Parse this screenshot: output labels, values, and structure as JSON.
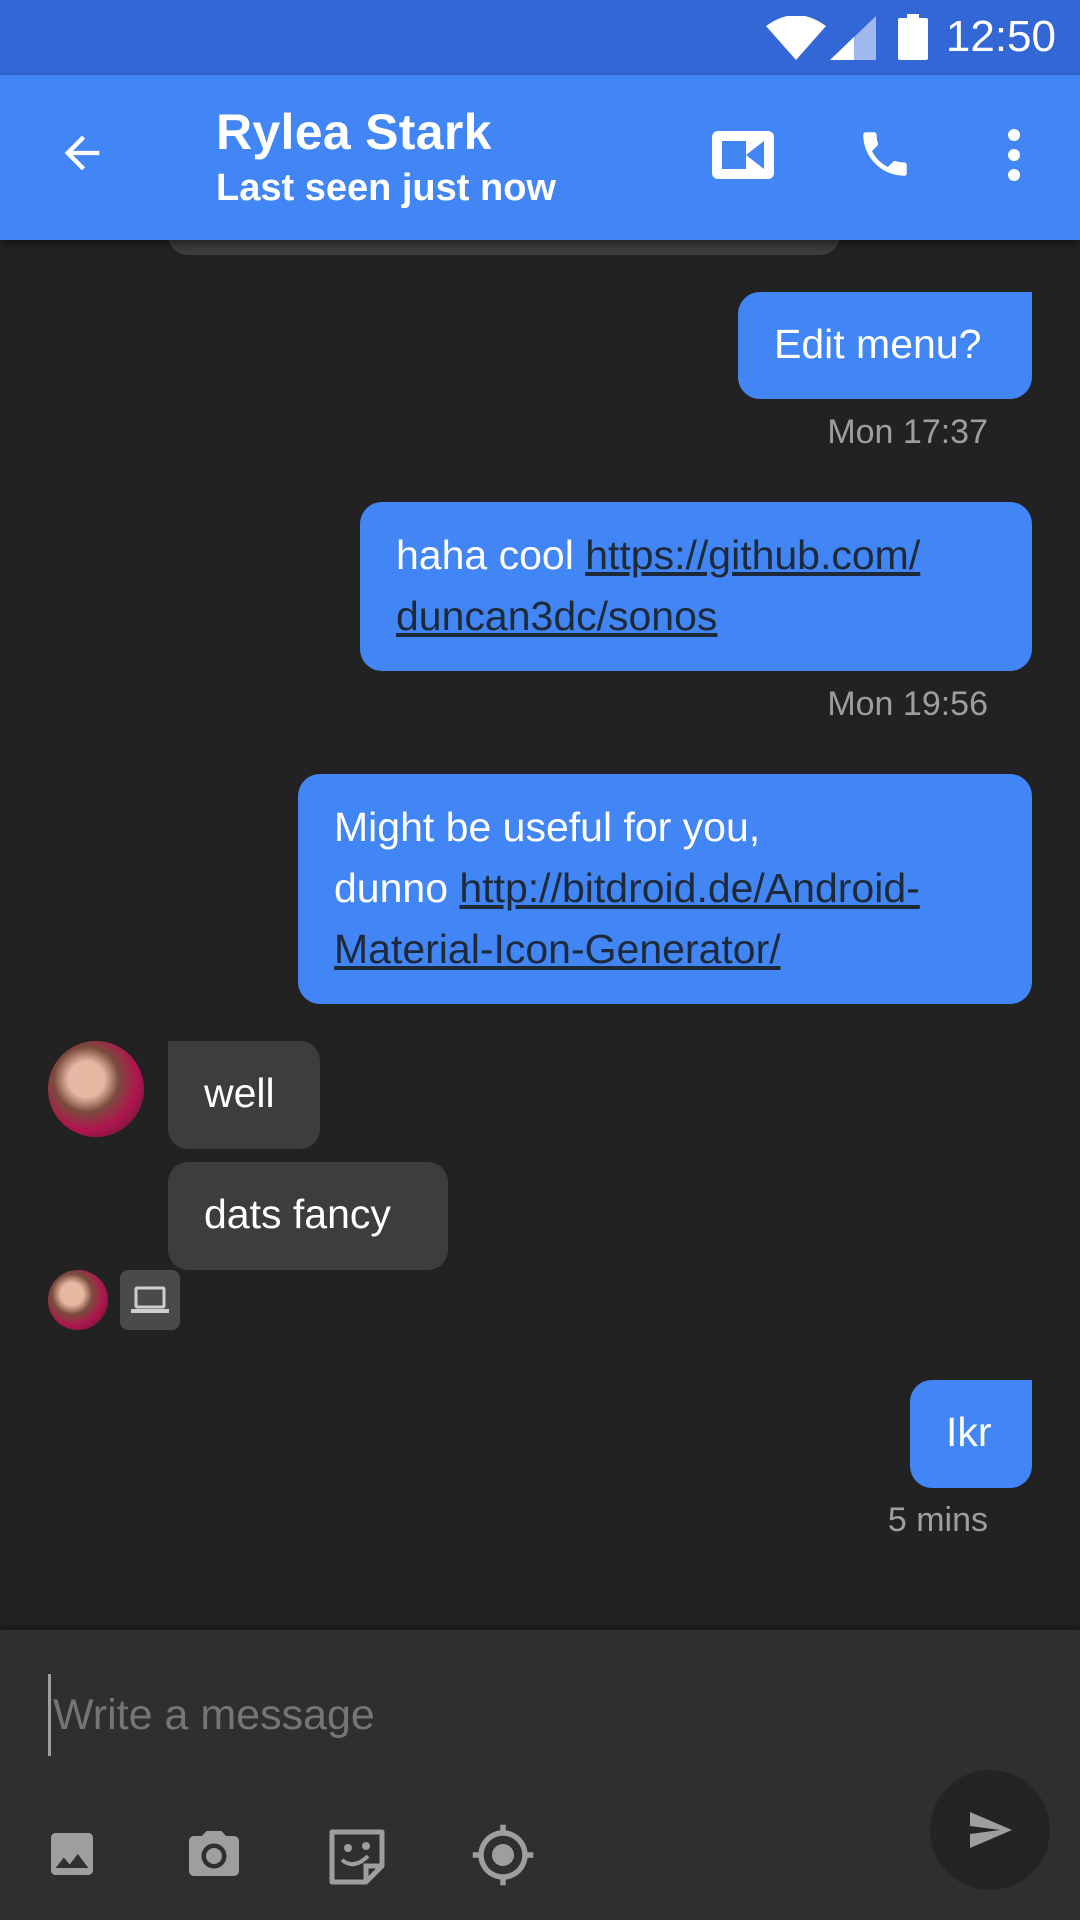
{
  "status_bar": {
    "time": "12:50"
  },
  "header": {
    "title": "Rylea Stark",
    "subtitle": "Last seen just now"
  },
  "messages": [
    {
      "dir": "out",
      "text": "Edit menu?",
      "time": "Mon 17:37"
    },
    {
      "dir": "out",
      "text": "haha cool ",
      "link": "https://github.com/duncan3dc/sonos",
      "link_line1": "https://github.com/",
      "link_line2": "duncan3dc/sonos",
      "time": "Mon 19:56"
    },
    {
      "dir": "out",
      "line1": "Might be useful for you,",
      "text": "dunno ",
      "link_line1": "http://bitdroid.de/Android-",
      "link_line2": "Material-Icon-Generator/"
    },
    {
      "dir": "in",
      "text": "well"
    },
    {
      "dir": "in",
      "text": "dats fancy"
    },
    {
      "dir": "out",
      "text": "Ikr",
      "time": "5 mins"
    }
  ],
  "composer": {
    "placeholder": "Write a message"
  },
  "colors": {
    "status_bar": "#3367d6",
    "app_bar": "#4285f4",
    "outgoing_bubble": "#4285f4",
    "incoming_bubble": "#3d3d3d",
    "background": "#222222"
  },
  "icons": [
    "back-arrow-icon",
    "video-call-icon",
    "phone-icon",
    "more-vert-icon",
    "image-icon",
    "camera-icon",
    "sticker-icon",
    "location-icon",
    "send-icon",
    "laptop-icon"
  ]
}
